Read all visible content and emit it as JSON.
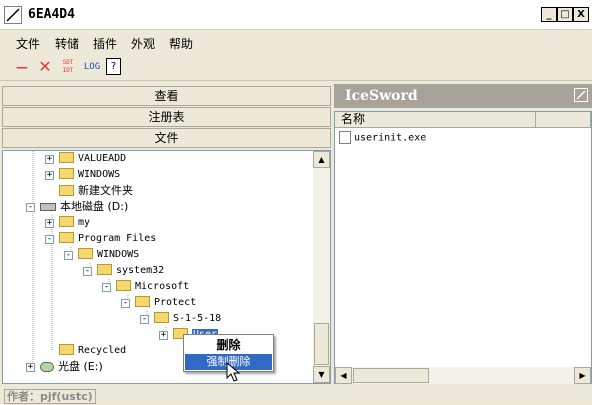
{
  "window": {
    "title": "6EA4D4",
    "minimize": "_",
    "maximize": "□",
    "close": "X"
  },
  "menu": [
    "文件",
    "转储",
    "插件",
    "外观",
    "帮助"
  ],
  "toolbar": {
    "logout_label": "—",
    "delete_label": "✕",
    "sdt_label": "SDT IDT",
    "log_label": "LOG",
    "help_label": "?"
  },
  "left_panel": {
    "tabs": [
      "查看",
      "注册表",
      "文件"
    ]
  },
  "tree": {
    "items": [
      {
        "label": "VALUEADD",
        "type": "folder",
        "expander": "+"
      },
      {
        "label": "WINDOWS",
        "type": "folder",
        "expander": "+"
      },
      {
        "label": "新建文件夹",
        "type": "folder",
        "expander": ""
      },
      {
        "label": "本地磁盘 (D:)",
        "type": "drive",
        "expander": "-"
      },
      {
        "label": "my",
        "type": "folder",
        "expander": "+"
      },
      {
        "label": "Program Files",
        "type": "folder",
        "expander": "-"
      },
      {
        "label": "WINDOWS",
        "type": "folder",
        "expander": "-"
      },
      {
        "label": "system32",
        "type": "folder",
        "expander": "-"
      },
      {
        "label": "Microsoft",
        "type": "folder",
        "expander": "-"
      },
      {
        "label": "Protect",
        "type": "folder",
        "expander": "-"
      },
      {
        "label": "S-1-5-18",
        "type": "folder",
        "expander": "-"
      },
      {
        "label": "User",
        "type": "folder",
        "expander": "+"
      },
      {
        "label": "Recycled",
        "type": "folder",
        "expander": ""
      },
      {
        "label": "光盘 (E:)",
        "type": "cdrom",
        "expander": "+"
      }
    ]
  },
  "right_panel": {
    "title": "IceSword",
    "columns": [
      "名称",
      ""
    ],
    "files": [
      "userinit.exe"
    ]
  },
  "context_menu": {
    "items": [
      "删除",
      "强制删除"
    ]
  },
  "status": {
    "text": "作者：pjf(ustc)"
  },
  "scroll": {
    "up": "▲",
    "down": "▼",
    "left": "◀",
    "right": "▶"
  }
}
